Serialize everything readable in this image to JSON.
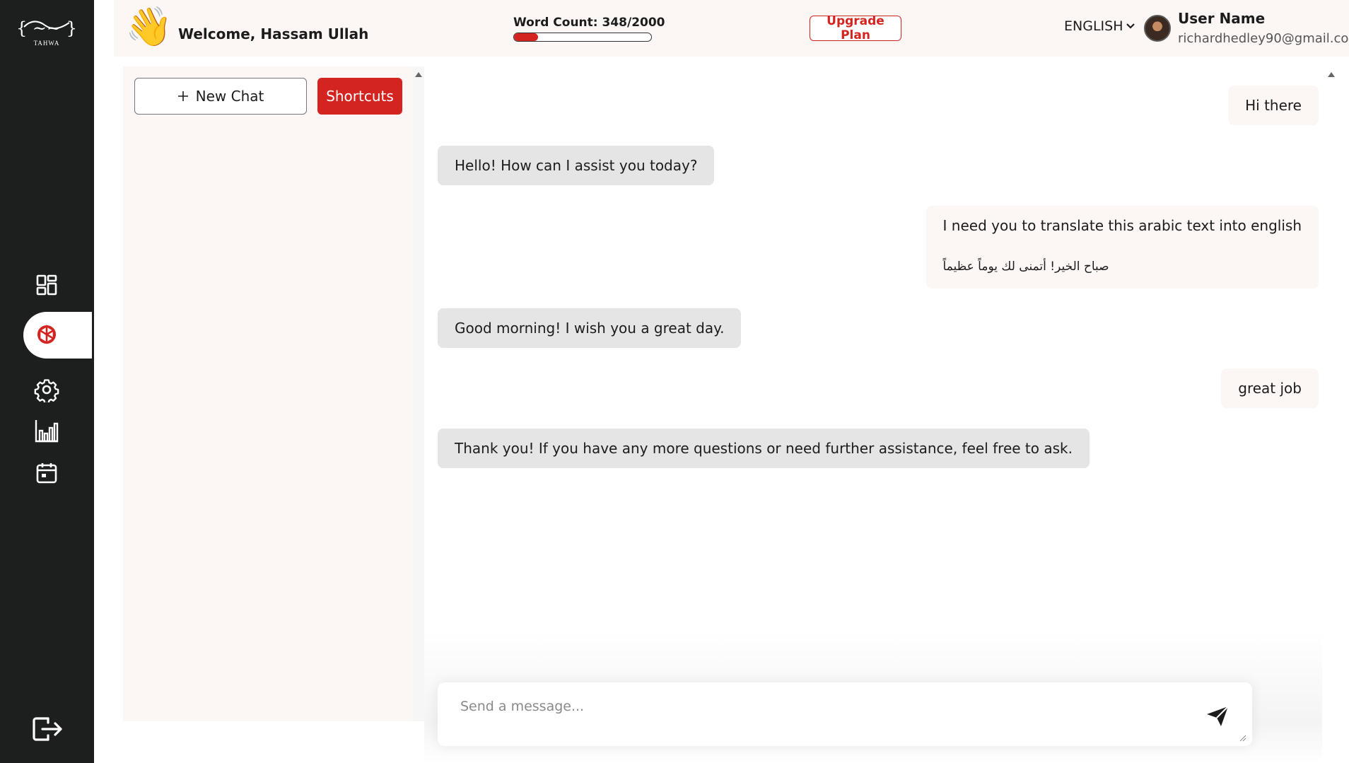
{
  "logo": {
    "arabic": "{ألمحوى}",
    "latin": "TAHWA"
  },
  "sidebar": {
    "items": [
      {
        "name": "dashboard",
        "icon": "dashboard-grid-icon"
      },
      {
        "name": "chat",
        "icon": "openai-logo-icon",
        "active": true
      },
      {
        "name": "settings",
        "icon": "gear-icon"
      },
      {
        "name": "analytics",
        "icon": "bar-chart-icon"
      },
      {
        "name": "calendar",
        "icon": "calendar-icon"
      }
    ],
    "logout_icon": "logout-icon"
  },
  "header": {
    "wave_emoji": "👋",
    "welcome": "Welcome, Hassam Ullah",
    "word_count_label": "Word Count:  348/2000",
    "word_count_used": 348,
    "word_count_total": 2000,
    "upgrade_label": "Upgrade Plan",
    "language": "ENGLISH",
    "user_name": "User Name",
    "user_email": "richardhedley90@gmail.com"
  },
  "chats_panel": {
    "new_chat_label": "New Chat",
    "shortcuts_label": "Shortcuts"
  },
  "messages": [
    {
      "role": "user",
      "text": "Hi there"
    },
    {
      "role": "bot",
      "text": "Hello! How can I assist you today?"
    },
    {
      "role": "user",
      "text": "I need you to translate this arabic text into english",
      "extra": "صباح الخير! أتمنى لك يوماً عظيماً"
    },
    {
      "role": "bot",
      "text": "Good morning! I wish you a great day."
    },
    {
      "role": "user",
      "text": "great job"
    },
    {
      "role": "bot",
      "text": "Thank you! If you have any more questions or need further assistance, feel free to ask."
    }
  ],
  "composer": {
    "placeholder": "Send a message...",
    "send_icon": "send-icon"
  },
  "colors": {
    "sidebar_bg": "#1c1f1d",
    "accent": "#d32420",
    "panel_bg": "#fcf6f5",
    "bot_bubble": "#e5e5e5"
  }
}
